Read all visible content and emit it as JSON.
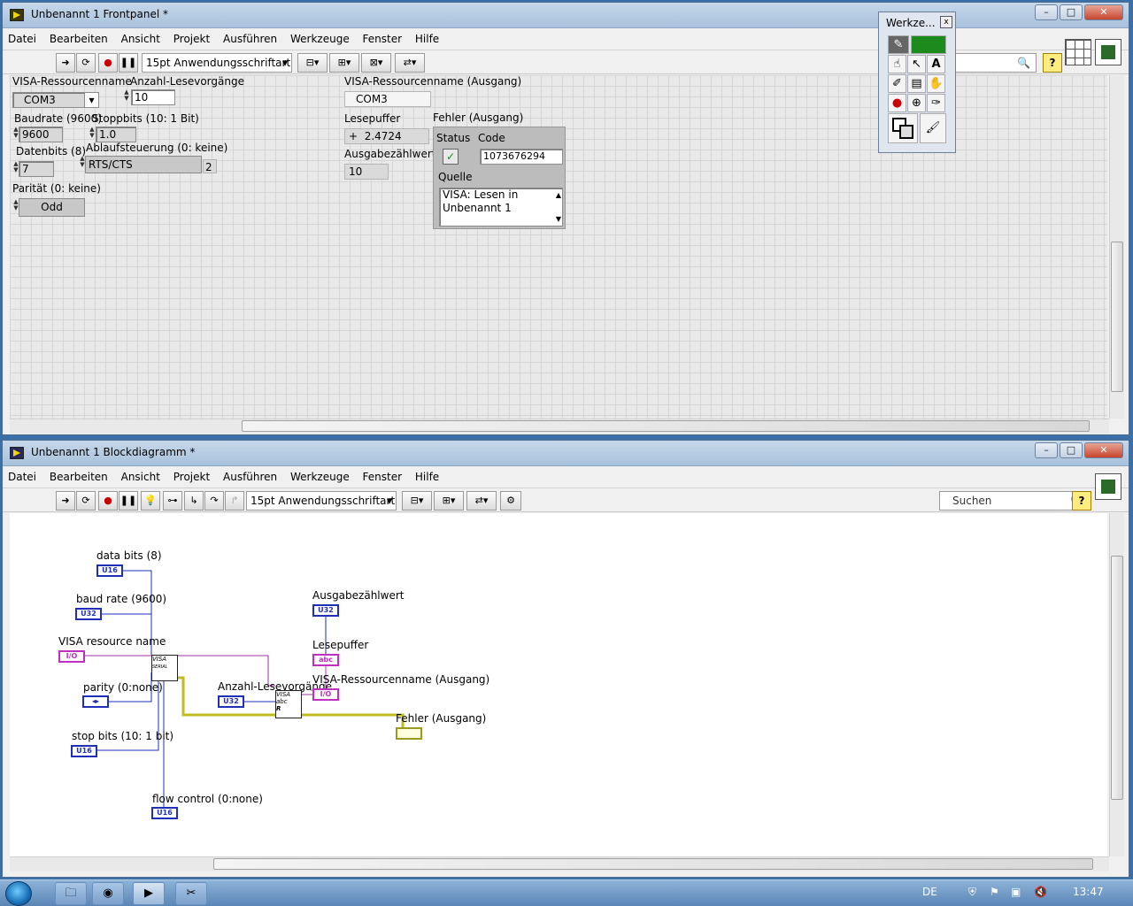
{
  "frontpanel": {
    "title": "Unbenannt 1 Frontpanel *",
    "menu": [
      "Datei",
      "Bearbeiten",
      "Ansicht",
      "Projekt",
      "Ausführen",
      "Werkzeuge",
      "Fenster",
      "Hilfe"
    ],
    "font_selector": "15pt Anwendungsschriftart",
    "controls": {
      "visa_resource_label": "VISA-Ressourcenname",
      "visa_resource_value": "COM3",
      "read_count_label": "Anzahl-Lesevorgänge",
      "read_count_value": "10",
      "baud_label": "Baudrate (9600)",
      "baud_value": "9600",
      "stop_label": "Stoppbits (10: 1 Bit)",
      "stop_value": "1.0",
      "data_bits_label": "Datenbits (8)",
      "data_bits_value": "7",
      "flow_label": "Ablaufsteuerung (0: keine)",
      "flow_value": "RTS/CTS",
      "flow_index": "2",
      "parity_label": "Parität (0: keine)",
      "parity_value": "Odd"
    },
    "indicators": {
      "visa_out_label": "VISA-Ressourcenname (Ausgang)",
      "visa_out_value": "COM3",
      "read_buffer_label": "Lesepuffer",
      "read_buffer_value": "2.4724",
      "read_buffer_prefix": "+",
      "return_count_label": "Ausgabezählwert",
      "return_count_value": "10",
      "error_label": "Fehler (Ausgang)",
      "status_label": "Status",
      "code_label": "Code",
      "code_value": "1073676294",
      "source_label": "Quelle",
      "source_value": "VISA: Lesen in Unbenannt 1"
    }
  },
  "tools_palette": {
    "title": "Werkze...",
    "close": "x"
  },
  "blockdiagram": {
    "title": "Unbenannt 1 Blockdiagramm *",
    "menu": [
      "Datei",
      "Bearbeiten",
      "Ansicht",
      "Projekt",
      "Ausführen",
      "Werkzeuge",
      "Fenster",
      "Hilfe"
    ],
    "font_selector": "15pt Anwendungsschriftart",
    "search_placeholder": "Suchen",
    "nodes": {
      "data_bits": "data bits (8)",
      "baud_rate": "baud rate (9600)",
      "visa_resource": "VISA resource name",
      "parity": "parity (0:none)",
      "stop_bits": "stop bits (10: 1 bit)",
      "flow_control": "flow control (0:none)",
      "read_count": "Anzahl-Lesevorgänge",
      "return_count": "Ausgabezählwert",
      "read_buffer": "Lesepuffer",
      "visa_out": "VISA-Ressourcenname (Ausgang)",
      "error_out": "Fehler (Ausgang)"
    },
    "terminal_types": {
      "u16": "U16",
      "u32": "U32",
      "io": "I/O",
      "abc": "abc",
      "enum": "◂▸"
    },
    "vi_labels": {
      "config": "VISA",
      "config_sub": "SERIAL",
      "read": "VISA",
      "read_sub": "abc",
      "read_r": "R"
    }
  },
  "taskbar": {
    "lang": "DE",
    "time": "13:47"
  },
  "window_controls": {
    "minimize": "–",
    "maximize": "□",
    "close": "✕"
  }
}
